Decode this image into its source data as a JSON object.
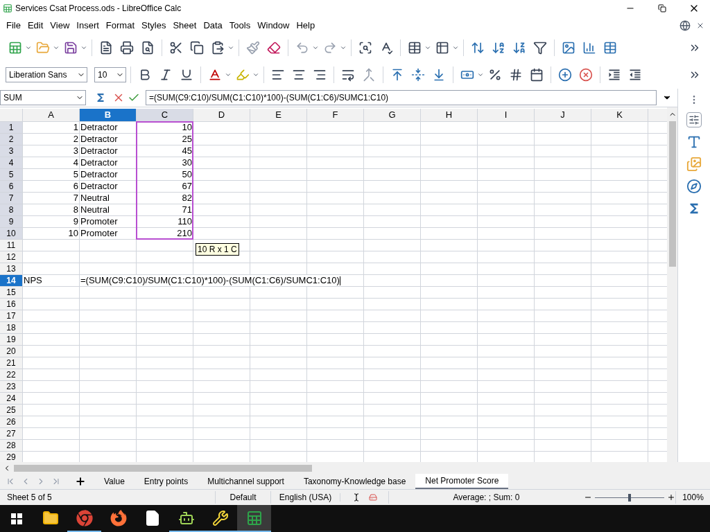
{
  "window": {
    "title": "Services Csat Process.ods - LibreOffice Calc"
  },
  "menu": [
    "File",
    "Edit",
    "View",
    "Insert",
    "Format",
    "Styles",
    "Sheet",
    "Data",
    "Tools",
    "Window",
    "Help"
  ],
  "toolbar": {
    "undo_disabled": true,
    "redo_disabled": true
  },
  "font": {
    "name": "Liberation Sans",
    "size": "10"
  },
  "formula_bar": {
    "name_box": "SUM",
    "formula": "=(SUM(C9:C10)/SUM(C1:C10)*100)-(SUM(C1:C6)/SUMC1:C10)"
  },
  "columns": [
    {
      "label": "A",
      "selected": false,
      "in_range": false
    },
    {
      "label": "B",
      "selected": true,
      "in_range": false
    },
    {
      "label": "C",
      "selected": false,
      "in_range": true
    },
    {
      "label": "D",
      "selected": false,
      "in_range": false
    },
    {
      "label": "E",
      "selected": false,
      "in_range": false
    },
    {
      "label": "F",
      "selected": false,
      "in_range": false
    },
    {
      "label": "G",
      "selected": false,
      "in_range": false
    },
    {
      "label": "H",
      "selected": false,
      "in_range": false
    },
    {
      "label": "I",
      "selected": false,
      "in_range": false
    },
    {
      "label": "J",
      "selected": false,
      "in_range": false
    },
    {
      "label": "K",
      "selected": false,
      "in_range": false
    }
  ],
  "rows": [
    {
      "label": "1",
      "selected": false,
      "in_range": true,
      "cells": [
        "1",
        "Detractor",
        "10"
      ]
    },
    {
      "label": "2",
      "selected": false,
      "in_range": true,
      "cells": [
        "2",
        "Detractor",
        "25"
      ]
    },
    {
      "label": "3",
      "selected": false,
      "in_range": true,
      "cells": [
        "3",
        "Detractor",
        "45"
      ]
    },
    {
      "label": "4",
      "selected": false,
      "in_range": true,
      "cells": [
        "4",
        "Detractor",
        "30"
      ]
    },
    {
      "label": "5",
      "selected": false,
      "in_range": true,
      "cells": [
        "5",
        "Detractor",
        "50"
      ]
    },
    {
      "label": "6",
      "selected": false,
      "in_range": true,
      "cells": [
        "6",
        "Detractor",
        "67"
      ]
    },
    {
      "label": "7",
      "selected": false,
      "in_range": true,
      "cells": [
        "7",
        "Neutral",
        "82"
      ]
    },
    {
      "label": "8",
      "selected": false,
      "in_range": true,
      "cells": [
        "8",
        "Neutral",
        "71"
      ]
    },
    {
      "label": "9",
      "selected": false,
      "in_range": true,
      "cells": [
        "9",
        "Promoter",
        "110"
      ]
    },
    {
      "label": "10",
      "selected": false,
      "in_range": true,
      "cells": [
        "10",
        "Promoter",
        "210"
      ]
    },
    {
      "label": "11",
      "selected": false,
      "in_range": false,
      "cells": []
    },
    {
      "label": "12",
      "selected": false,
      "in_range": false,
      "cells": []
    },
    {
      "label": "13",
      "selected": false,
      "in_range": false,
      "cells": []
    },
    {
      "label": "14",
      "selected": true,
      "in_range": false,
      "cells": [
        "NPS",
        "=(SUM(C9:C10)/SUM(C1:C10)*100)-(SUM(C1:C6)/SUMC1:C10)"
      ]
    },
    {
      "label": "15",
      "selected": false,
      "in_range": false,
      "cells": []
    },
    {
      "label": "16",
      "selected": false,
      "in_range": false,
      "cells": []
    },
    {
      "label": "17",
      "selected": false,
      "in_range": false,
      "cells": []
    },
    {
      "label": "18",
      "selected": false,
      "in_range": false,
      "cells": []
    },
    {
      "label": "19",
      "selected": false,
      "in_range": false,
      "cells": []
    },
    {
      "label": "20",
      "selected": false,
      "in_range": false,
      "cells": []
    },
    {
      "label": "21",
      "selected": false,
      "in_range": false,
      "cells": []
    },
    {
      "label": "22",
      "selected": false,
      "in_range": false,
      "cells": []
    },
    {
      "label": "23",
      "selected": false,
      "in_range": false,
      "cells": []
    },
    {
      "label": "24",
      "selected": false,
      "in_range": false,
      "cells": []
    },
    {
      "label": "25",
      "selected": false,
      "in_range": false,
      "cells": []
    },
    {
      "label": "26",
      "selected": false,
      "in_range": false,
      "cells": []
    },
    {
      "label": "27",
      "selected": false,
      "in_range": false,
      "cells": []
    },
    {
      "label": "28",
      "selected": false,
      "in_range": false,
      "cells": []
    },
    {
      "label": "29",
      "selected": false,
      "in_range": false,
      "cells": []
    }
  ],
  "tooltip": "10 R x 1 C",
  "sheet_tabs": [
    {
      "label": "Value",
      "selected": false
    },
    {
      "label": "Entry points",
      "selected": false
    },
    {
      "label": "Multichannel support",
      "selected": false
    },
    {
      "label": "Taxonomy-Knowledge base",
      "selected": false
    },
    {
      "label": "Net Promoter Score",
      "selected": true
    }
  ],
  "status_bar": {
    "sheet": "Sheet 5 of 5",
    "page_style": "Default",
    "language": "English (USA)",
    "summary": "Average: ; Sum: 0",
    "zoom": "100%",
    "zoom_slider": {
      "level": 0.5
    }
  },
  "taskbar": [
    {
      "kind": "folder",
      "open": false,
      "selected": false
    },
    {
      "kind": "chrome",
      "open": true,
      "selected": false
    },
    {
      "kind": "firefox",
      "open": false,
      "selected": false
    },
    {
      "kind": "file",
      "open": false,
      "selected": false
    },
    {
      "kind": "app",
      "open": true,
      "selected": false
    },
    {
      "kind": "tool",
      "open": true,
      "selected": false
    },
    {
      "kind": "calc",
      "open": true,
      "selected": true
    }
  ]
}
